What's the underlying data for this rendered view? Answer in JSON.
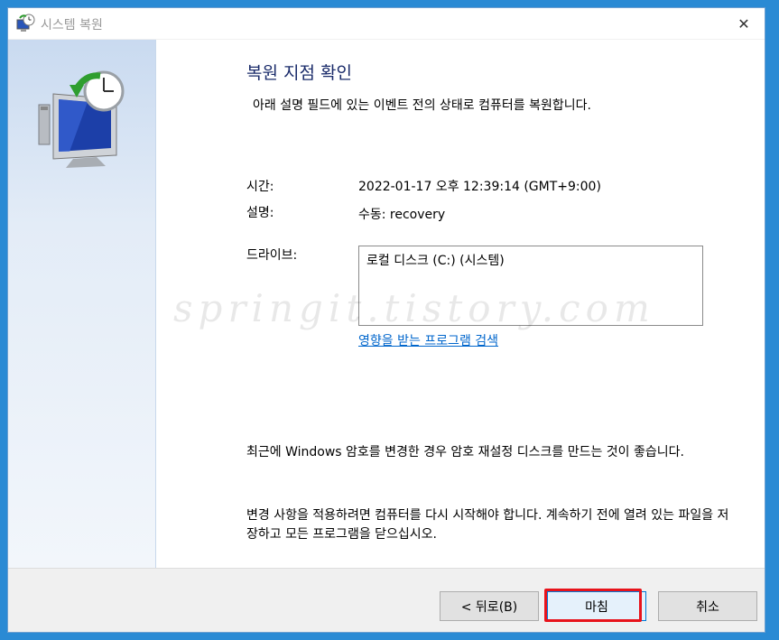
{
  "window": {
    "title": "시스템 복원",
    "close_symbol": "✕"
  },
  "icons": {
    "title": "system-restore-icon",
    "sidebar": "restore-computer-clock-icon",
    "close": "close-icon"
  },
  "content": {
    "heading": "복원 지점 확인",
    "description": "아래 설명 필드에 있는 이벤트 전의 상태로 컴퓨터를 복원합니다.",
    "time_label": "시간:",
    "time_value": "2022-01-17 오후 12:39:14 (GMT+9:00)",
    "desc_label": "설명:",
    "desc_value": "수동: recovery",
    "drives_label": "드라이브:",
    "drives": [
      "로컬 디스크 (C:) (시스템)"
    ],
    "affected_link": "영향을 받는 프로그램 검색",
    "password_notice": "최근에 Windows 암호를 변경한 경우 암호 재설정 디스크를 만드는 것이 좋습니다.",
    "restart_notice": "변경 사항을 적용하려면 컴퓨터를 다시 시작해야 합니다. 계속하기 전에 열려 있는 파일을 저장하고 모든 프로그램을 닫으십시오."
  },
  "watermark": "springit.tistory.com",
  "buttons": {
    "back": "< 뒤로(B)",
    "finish": "마침",
    "cancel": "취소"
  },
  "colors": {
    "desktop": "#2a8ad4",
    "heading": "#1a2b6a",
    "link": "#0066cc",
    "highlight": "#e8131b"
  }
}
